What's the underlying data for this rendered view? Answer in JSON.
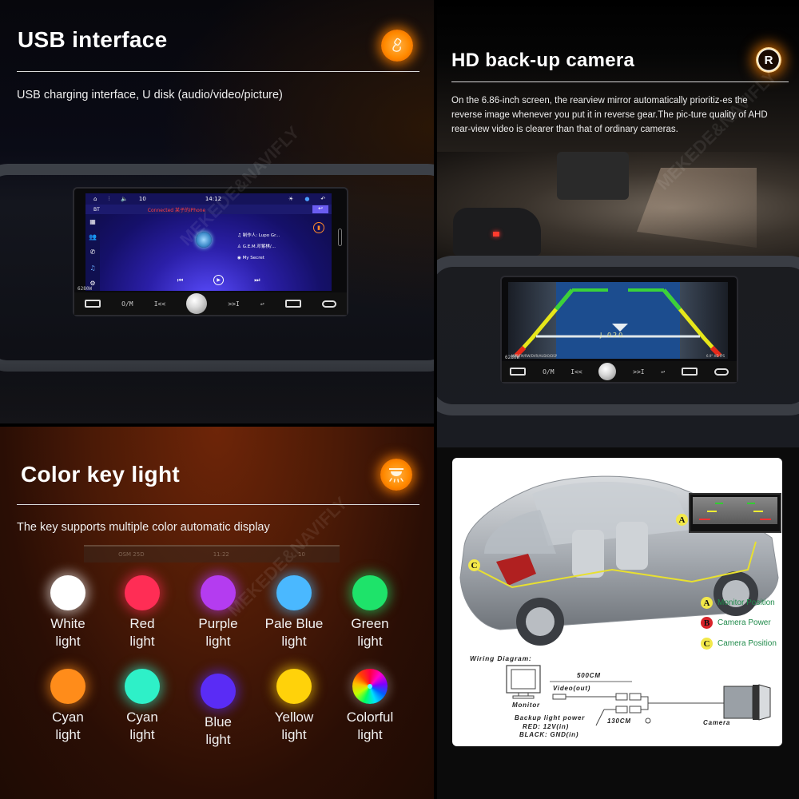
{
  "usb_section": {
    "title": "USB interface",
    "description": "USB charging interface, U disk (audio/video/picture)",
    "icon": "usb-cable-icon",
    "head_unit": {
      "volume": "10",
      "time": "14:12",
      "bt_label": "BT",
      "connection_status": "Connected 某子的iPhone",
      "tracks": [
        "制作人: Lupo Gr...",
        "G.E.M.邓紫棋/...",
        "My Secret"
      ],
      "model": "6280W",
      "button_om": "O/M",
      "button_prev": "I<<",
      "button_next": ">>I"
    }
  },
  "camera_section": {
    "title": "HD back-up camera",
    "description": "On the 6.86-inch screen, the rearview mirror automatically prioritiz-es the reverse image whenever you put it in reverse gear.The pic-ture quality of AHD rear-view video is clearer than that of ordinary cameras.",
    "icon": "reverse-gear-r-icon",
    "head_unit": {
      "model": "6280W",
      "screen_text": "J-020",
      "top_label": "MP5/FM/RW/DVR/AUDIO/DSP",
      "size_label": "6.9\" HD IPS",
      "button_om": "O/M",
      "button_prev": "I<<",
      "button_next": ">>I"
    }
  },
  "color_section": {
    "title": "Color key light",
    "description": "The key supports multiple color automatic display",
    "icon": "ceiling-lamp-icon",
    "backdrop_strip": {
      "left": "OSM 25D",
      "center": "11:22",
      "right": "10"
    },
    "lights": [
      {
        "line1": "White",
        "line2": "light",
        "color": "#ffffff"
      },
      {
        "line1": "Red",
        "line2": "light",
        "color": "#ff2d55"
      },
      {
        "line1": "Purple",
        "line2": "light",
        "color": "#b43cf0"
      },
      {
        "line1": "Pale Blue",
        "line2": "light",
        "color": "#4ab8ff"
      },
      {
        "line1": "Green",
        "line2": "light",
        "color": "#1ee36a"
      },
      {
        "line1": "Cyan",
        "line2": "light",
        "color": "#ff8c1a"
      },
      {
        "line1": "Cyan",
        "line2": "light",
        "color": "#2ef0c8"
      },
      {
        "line1": "Blue",
        "line2": "light",
        "color": "#5a2cf5"
      },
      {
        "line1": "Yellow",
        "line2": "light",
        "color": "#ffd20a"
      },
      {
        "line1": "Colorful",
        "line2": "light",
        "color": "rainbow"
      }
    ]
  },
  "diagram_section": {
    "legend": [
      {
        "letter": "A",
        "label": "Monitor Position",
        "color": "#f2e84a"
      },
      {
        "letter": "B",
        "label": "Camera Power",
        "color": "#d8232a"
      },
      {
        "letter": "C",
        "label": "Camera Position",
        "color": "#f2e84a"
      }
    ],
    "wiring": {
      "title": "Wiring Diagram:",
      "length_video": "500CM",
      "video_label": "Video(out)",
      "monitor_label": "Monitor",
      "power_label": "Backup light power",
      "red_label": "RED: 12V(in)",
      "black_label": "BLACK: GND(in)",
      "length_power": "130CM",
      "camera_label": "Camera"
    }
  },
  "watermark": "MEKEDE&NAVIFLY"
}
